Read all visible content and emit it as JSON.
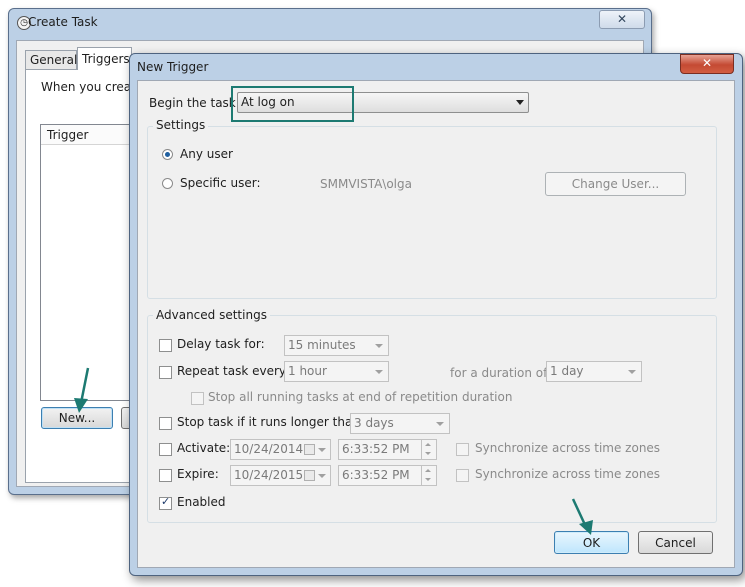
{
  "create_task": {
    "title": "Create Task",
    "close": "✕",
    "tabs": [
      "General",
      "Triggers"
    ],
    "when_text": "When you create",
    "list_header": "Trigger",
    "new_button": "New..."
  },
  "new_trigger": {
    "title": "New Trigger",
    "close": "✕",
    "begin_label": "Begin the task:",
    "begin_value": "At log on",
    "settings": {
      "legend": "Settings",
      "any_user": "Any user",
      "specific_user": "Specific user:",
      "user_value": "SMMVISTA\\olga",
      "change_user": "Change User..."
    },
    "advanced": {
      "legend": "Advanced settings",
      "delay_label": "Delay task for:",
      "delay_value": "15 minutes",
      "repeat_label": "Repeat task every:",
      "repeat_value": "1 hour",
      "duration_label": "for a duration of:",
      "duration_value": "1 day",
      "stop_running": "Stop all running tasks at end of repetition duration",
      "stop_longer_label": "Stop task if it runs longer than:",
      "stop_longer_value": "3 days",
      "activate_label": "Activate:",
      "activate_date": "10/24/2014",
      "activate_time": "6:33:52 PM",
      "expire_label": "Expire:",
      "expire_date": "10/24/2015",
      "expire_time": "6:33:52 PM",
      "sync": "Synchronize across time zones",
      "enabled_label": "Enabled"
    },
    "ok": "OK",
    "cancel": "Cancel"
  },
  "colors": {
    "accent": "#1d7a72",
    "title_bar": "#bcd0e6",
    "close_red": "#c44a33"
  }
}
